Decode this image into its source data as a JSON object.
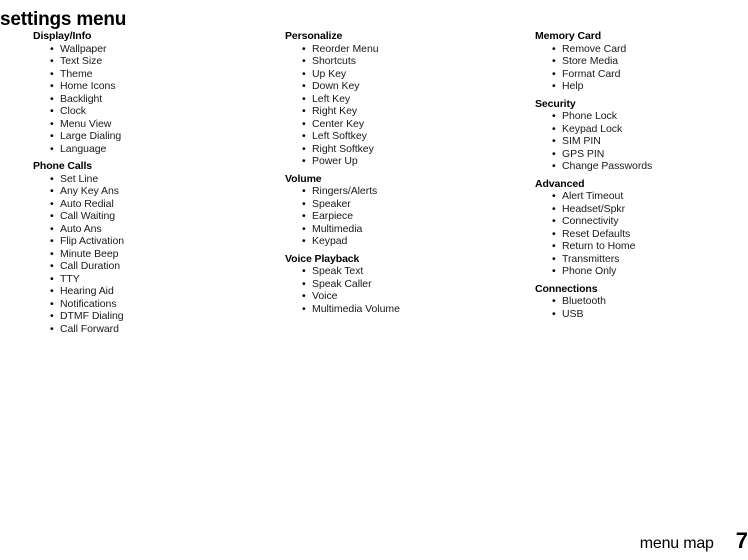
{
  "page": {
    "title": "settings menu",
    "footer_label": "menu map",
    "page_number": "7",
    "bullet_glyph": "•"
  },
  "columns": [
    {
      "sections": [
        {
          "header": "Display/Info",
          "items": [
            "Wallpaper",
            "Text Size",
            "Theme",
            "Home Icons",
            "Backlight",
            "Clock",
            "Menu View",
            "Large Dialing",
            "Language"
          ]
        },
        {
          "header": "Phone Calls",
          "items": [
            "Set Line",
            "Any Key Ans",
            "Auto Redial",
            "Call Waiting",
            "Auto Ans",
            "Flip Activation",
            "Minute Beep",
            "Call Duration",
            "TTY",
            "Hearing Aid",
            "Notifications",
            "DTMF Dialing",
            "Call Forward"
          ]
        }
      ]
    },
    {
      "sections": [
        {
          "header": "Personalize",
          "items": [
            "Reorder Menu",
            "Shortcuts",
            "Up Key",
            "Down Key",
            "Left Key",
            "Right Key",
            "Center Key",
            "Left Softkey",
            "Right Softkey",
            "Power Up"
          ]
        },
        {
          "header": "Volume",
          "items": [
            "Ringers/Alerts",
            "Speaker",
            "Earpiece",
            "Multimedia",
            "Keypad"
          ]
        },
        {
          "header": "Voice Playback",
          "items": [
            "Speak Text",
            "Speak Caller",
            "Voice",
            "Multimedia Volume"
          ]
        }
      ]
    },
    {
      "sections": [
        {
          "header": "Memory Card",
          "items": [
            "Remove Card",
            "Store Media",
            "Format Card",
            "Help"
          ]
        },
        {
          "header": "Security",
          "items": [
            "Phone Lock",
            "Keypad Lock",
            "SIM PIN",
            "GPS PIN",
            "Change Passwords"
          ]
        },
        {
          "header": "Advanced",
          "items": [
            "Alert Timeout",
            "Headset/Spkr",
            "Connectivity",
            "Reset Defaults",
            "Return to Home",
            "Transmitters",
            "Phone Only"
          ]
        },
        {
          "header": "Connections",
          "items": [
            "Bluetooth",
            "USB"
          ]
        }
      ]
    }
  ]
}
